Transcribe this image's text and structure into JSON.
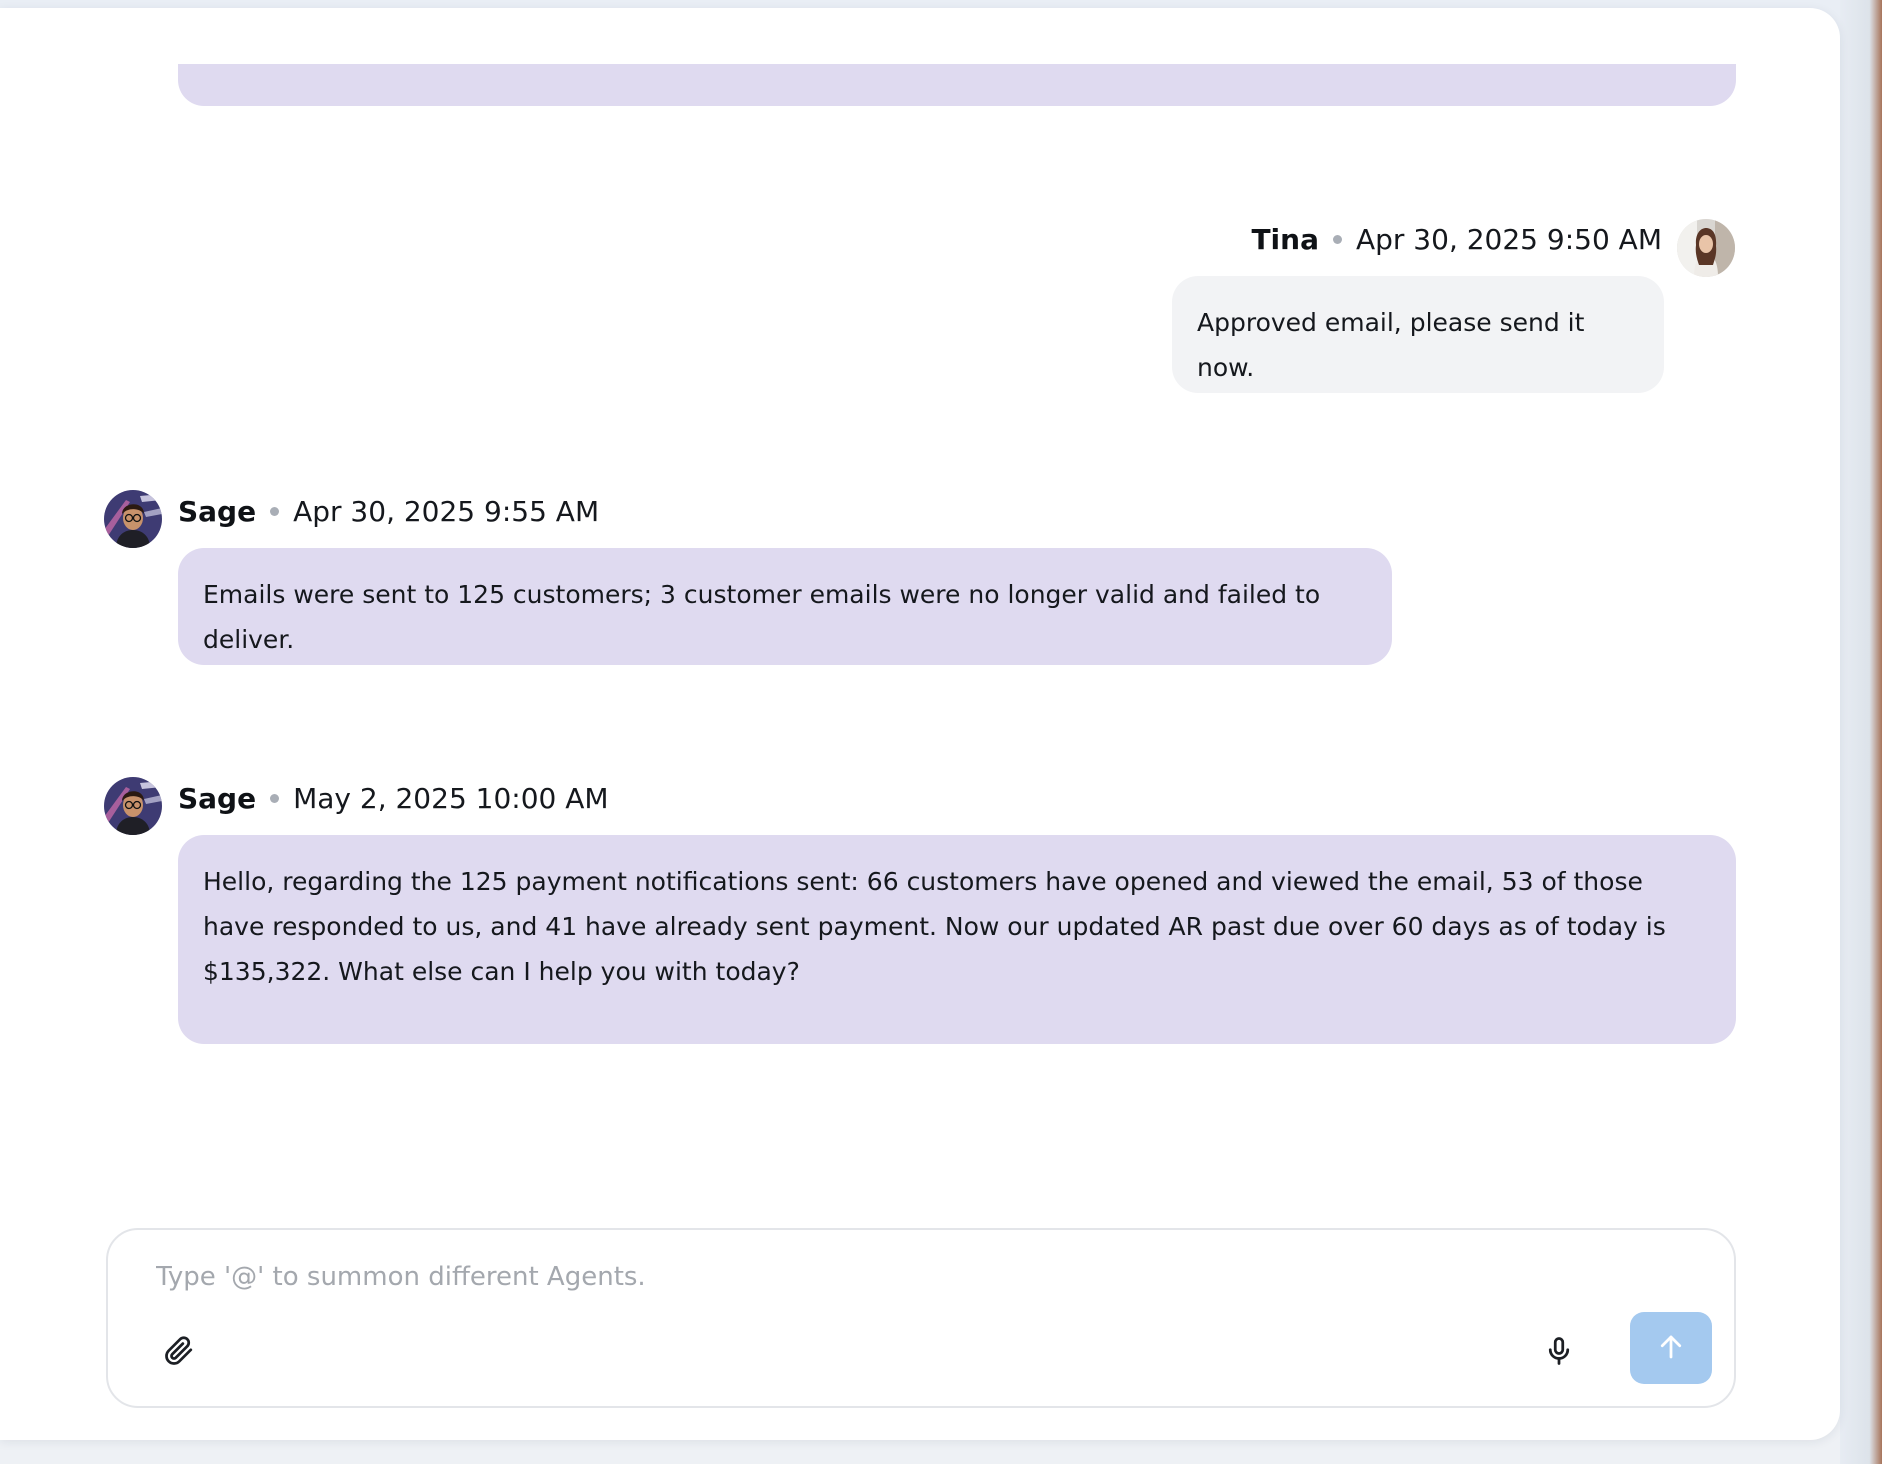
{
  "composer": {
    "placeholder": "Type '@' to summon different Agents.",
    "value": ""
  },
  "messages": [
    {
      "sender": "Tina",
      "timestamp": "Apr 30, 2025 9:50 AM",
      "text": "Approved email, please send it now."
    },
    {
      "sender": "Sage",
      "timestamp": "Apr 30, 2025 9:55 AM",
      "text": "Emails were sent to 125 customers; 3 customer emails were no longer valid and failed to deliver."
    },
    {
      "sender": "Sage",
      "timestamp": "May 2, 2025 10:00 AM",
      "text": "Hello, regarding the 125 payment notifications sent: 66 customers have opened and viewed the email, 53 of those have responded to us, and 41 have already sent payment. Now our updated AR past due over 60 days as of today is $135,322. What else can I help you with today?"
    }
  ],
  "colors": {
    "agent_bubble": "#dfdaf0",
    "user_bubble": "#f2f3f5",
    "send_button": "#a4c9ef"
  },
  "icons": {
    "attach": "paperclip-icon",
    "microphone": "microphone-icon",
    "send": "arrow-up-icon"
  }
}
